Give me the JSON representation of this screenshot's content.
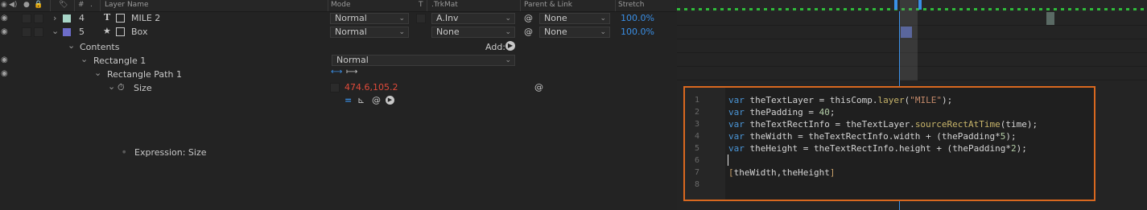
{
  "header": {
    "hash": "#",
    "dot": ".",
    "layer_name": "Layer Name",
    "mode": "Mode",
    "t": "T",
    "trkmat": ".TrkMat",
    "parent_link": "Parent & Link",
    "stretch": "Stretch"
  },
  "layers": [
    {
      "num": "4",
      "type_glyph": "T",
      "name": "MILE 2",
      "color": "#a8d6c8",
      "mode": "Normal",
      "trkmat": "A.Inv",
      "parent": "None",
      "stretch": "100.0%"
    },
    {
      "num": "5",
      "type_glyph": "★",
      "name": "Box",
      "color": "#6c6cc9",
      "mode": "Normal",
      "trkmat": "None",
      "parent": "None",
      "stretch": "100.0%"
    }
  ],
  "contents": {
    "label": "Contents",
    "add_label": "Add:"
  },
  "rectangle": {
    "label": "Rectangle 1",
    "mode": "Normal"
  },
  "rect_path": {
    "label": "Rectangle Path 1"
  },
  "size": {
    "label": "Size",
    "value": "474.6,105.2"
  },
  "expression": {
    "label": "Expression: Size"
  },
  "editor": {
    "line_numbers": [
      "1",
      "2",
      "3",
      "4",
      "5",
      "6",
      "7",
      "8"
    ]
  },
  "colors": {
    "accent_orange": "#d9681f",
    "stretch_blue": "#3a8fe6",
    "size_red": "#e04a3a",
    "keyword_blue": "#4a95d6"
  }
}
